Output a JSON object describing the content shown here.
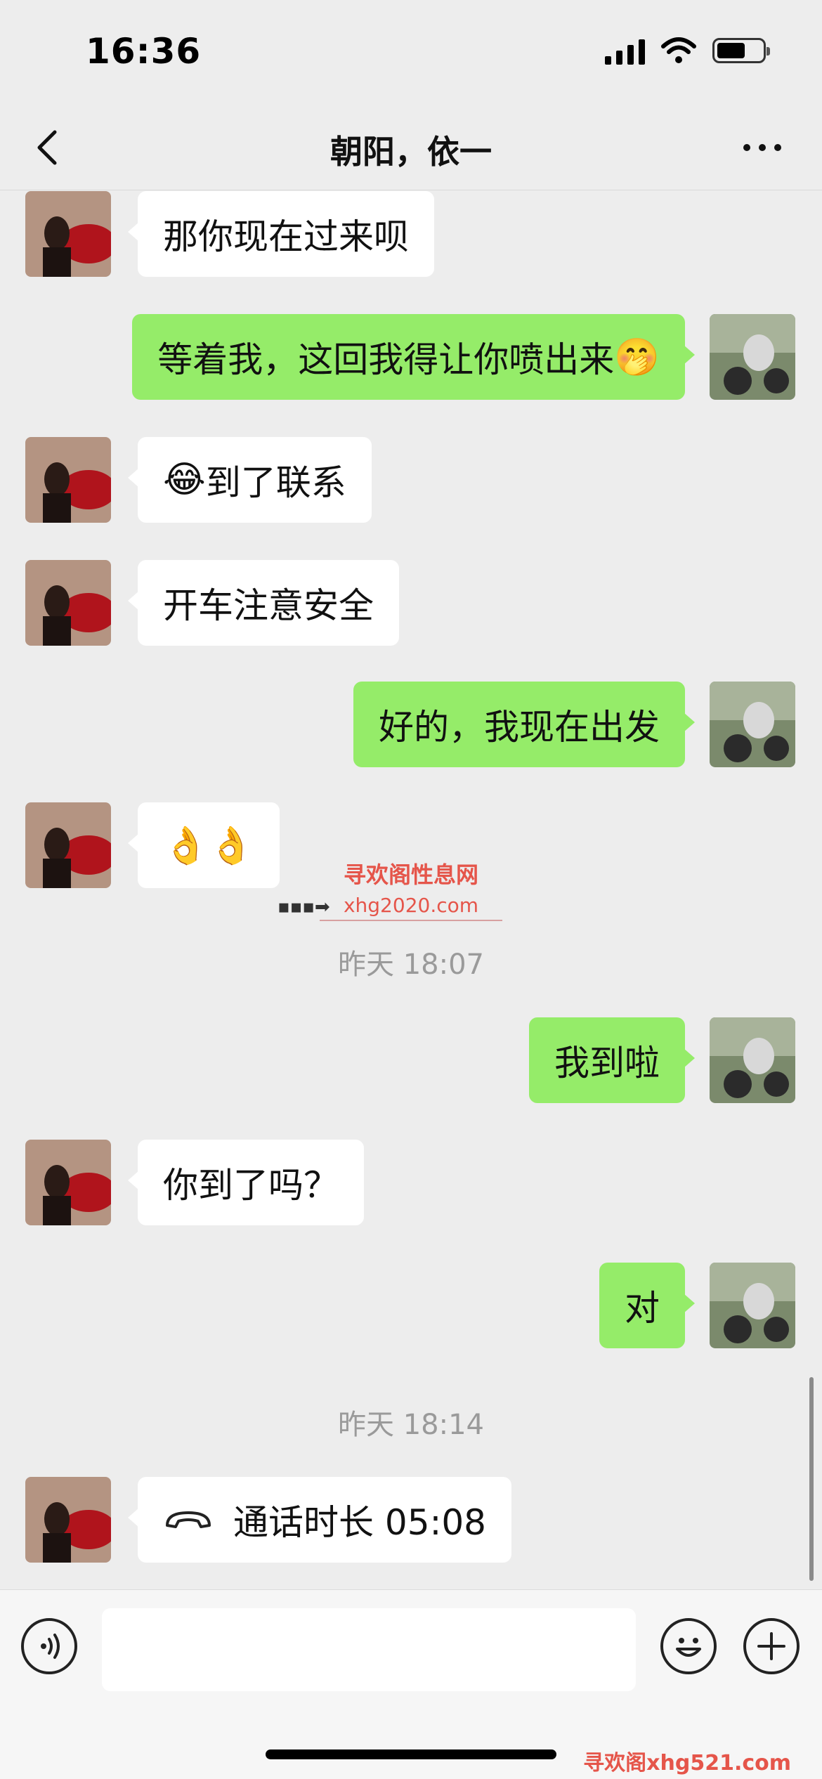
{
  "status_bar": {
    "time": "16:36",
    "icons": [
      "signal-icon",
      "wifi-icon",
      "battery-icon"
    ]
  },
  "nav": {
    "title": "朝阳，依一",
    "back_icon": "chevron-left-icon",
    "more_icon": "more-icon"
  },
  "colors": {
    "background": "#ededed",
    "incoming_bubble": "#ffffff",
    "outgoing_bubble": "#95ec69"
  },
  "messages": [
    {
      "side": "left",
      "text": "那你现在过来呗"
    },
    {
      "side": "right",
      "text": "等着我，这回我得让你喷出来",
      "emoji": "🤭"
    },
    {
      "side": "left",
      "emoji": "😂",
      "text": "到了联系"
    },
    {
      "side": "left",
      "text": "开车注意安全"
    },
    {
      "side": "right",
      "text": "好的，我现在出发"
    },
    {
      "side": "left",
      "emoji": "👌👌"
    },
    {
      "side": "right",
      "text": "我到啦"
    },
    {
      "side": "left",
      "text": "你到了吗？"
    },
    {
      "side": "right",
      "text": "对"
    },
    {
      "side": "left",
      "icon": "phone-icon",
      "text": "通话时长 05:08"
    }
  ],
  "timestamps": [
    "昨天 18:07",
    "昨天 18:14"
  ],
  "watermark": {
    "title": "寻欢阁性息网",
    "url": "xhg2020.com",
    "corner": "寻欢阁xhg521.com"
  },
  "input_bar": {
    "placeholder": "",
    "icons": [
      "voice-icon",
      "emoji-icon",
      "plus-icon"
    ]
  }
}
